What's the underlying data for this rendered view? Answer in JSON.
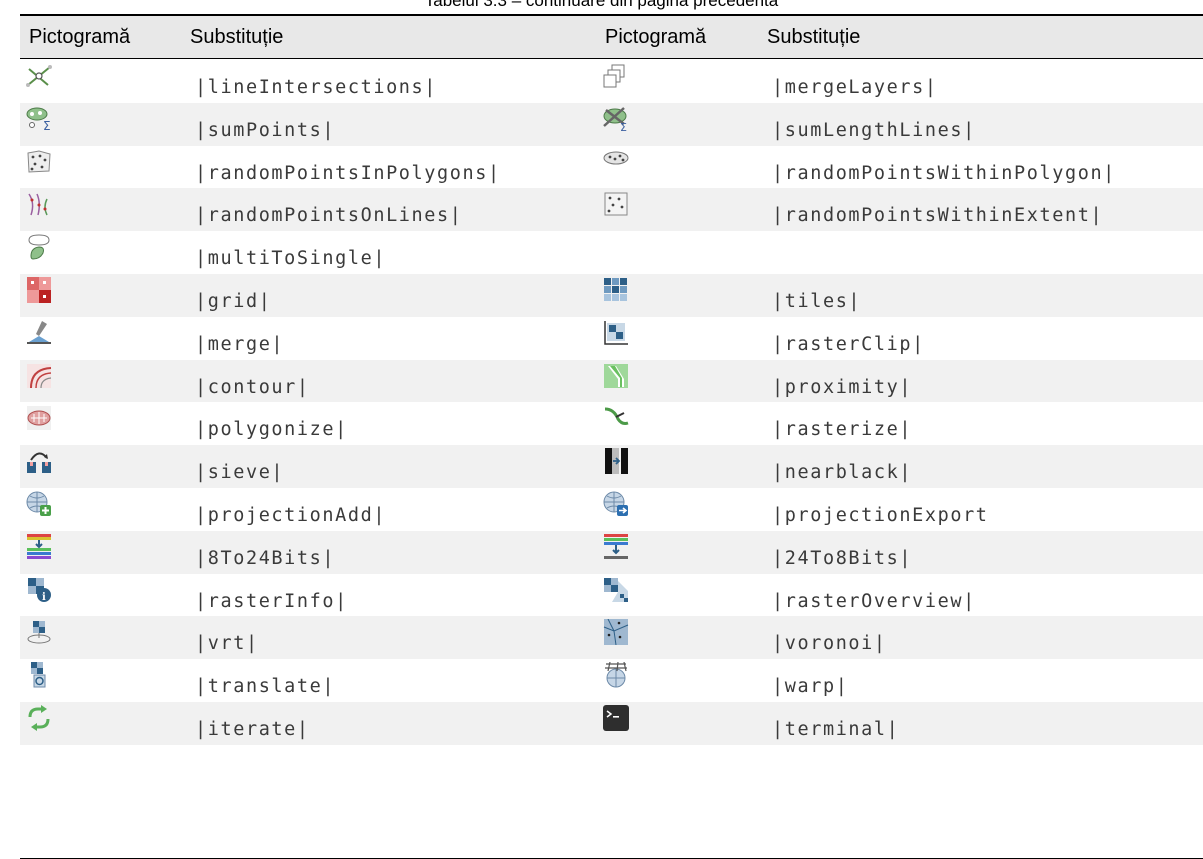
{
  "caption": "Tabelul 3.3 – continuare din pagina precedentă",
  "columns": {
    "icon_left": "Pictogramă",
    "sub_left": "Substituție",
    "icon_right": "Pictogramă",
    "sub_right": "Substituție"
  },
  "rows": [
    {
      "left": {
        "icon": "line-intersections-icon",
        "code": "|lineIntersections|"
      },
      "right": {
        "icon": "merge-layers-icon",
        "code": "|mergeLayers|"
      }
    },
    {
      "left": {
        "icon": "sum-points-icon",
        "code": "|sumPoints|"
      },
      "right": {
        "icon": "sum-length-lines-icon",
        "code": "|sumLengthLines|"
      }
    },
    {
      "left": {
        "icon": "random-points-in-polygons-icon",
        "code": "|randomPointsInPolygons|"
      },
      "right": {
        "icon": "random-points-within-polygon-icon",
        "code": "|randomPointsWithinPolygon|"
      }
    },
    {
      "left": {
        "icon": "random-points-on-lines-icon",
        "code": "|randomPointsOnLines|"
      },
      "right": {
        "icon": "random-points-within-extent-icon",
        "code": "|randomPointsWithinExtent|"
      }
    },
    {
      "left": {
        "icon": "multi-to-single-icon",
        "code": "|multiToSingle|"
      },
      "right": {
        "icon": "",
        "code": ""
      }
    },
    {
      "left": {
        "icon": "grid-icon",
        "code": "|grid|"
      },
      "right": {
        "icon": "tiles-icon",
        "code": "|tiles|"
      }
    },
    {
      "left": {
        "icon": "merge-icon",
        "code": "|merge|"
      },
      "right": {
        "icon": "raster-clip-icon",
        "code": "|rasterClip|"
      }
    },
    {
      "left": {
        "icon": "contour-icon",
        "code": "|contour|"
      },
      "right": {
        "icon": "proximity-icon",
        "code": "|proximity|"
      }
    },
    {
      "left": {
        "icon": "polygonize-icon",
        "code": "|polygonize|"
      },
      "right": {
        "icon": "rasterize-icon",
        "code": "|rasterize|"
      }
    },
    {
      "left": {
        "icon": "sieve-icon",
        "code": "|sieve|"
      },
      "right": {
        "icon": "nearblack-icon",
        "code": "|nearblack|"
      }
    },
    {
      "left": {
        "icon": "projection-add-icon",
        "code": "|projectionAdd|"
      },
      "right": {
        "icon": "projection-export-icon",
        "code": "|projectionExport"
      }
    },
    {
      "left": {
        "icon": "8-to-24-bits-icon",
        "code": "|8To24Bits|"
      },
      "right": {
        "icon": "24-to-8-bits-icon",
        "code": "|24To8Bits|"
      }
    },
    {
      "left": {
        "icon": "raster-info-icon",
        "code": "|rasterInfo|"
      },
      "right": {
        "icon": "raster-overview-icon",
        "code": "|rasterOverview|"
      }
    },
    {
      "left": {
        "icon": "vrt-icon",
        "code": "|vrt|"
      },
      "right": {
        "icon": "voronoi-icon",
        "code": "|voronoi|"
      }
    },
    {
      "left": {
        "icon": "translate-icon",
        "code": "|translate|"
      },
      "right": {
        "icon": "warp-icon",
        "code": "|warp|"
      }
    },
    {
      "left": {
        "icon": "iterate-icon",
        "code": "|iterate|"
      },
      "right": {
        "icon": "terminal-icon",
        "code": "|terminal|"
      }
    }
  ]
}
